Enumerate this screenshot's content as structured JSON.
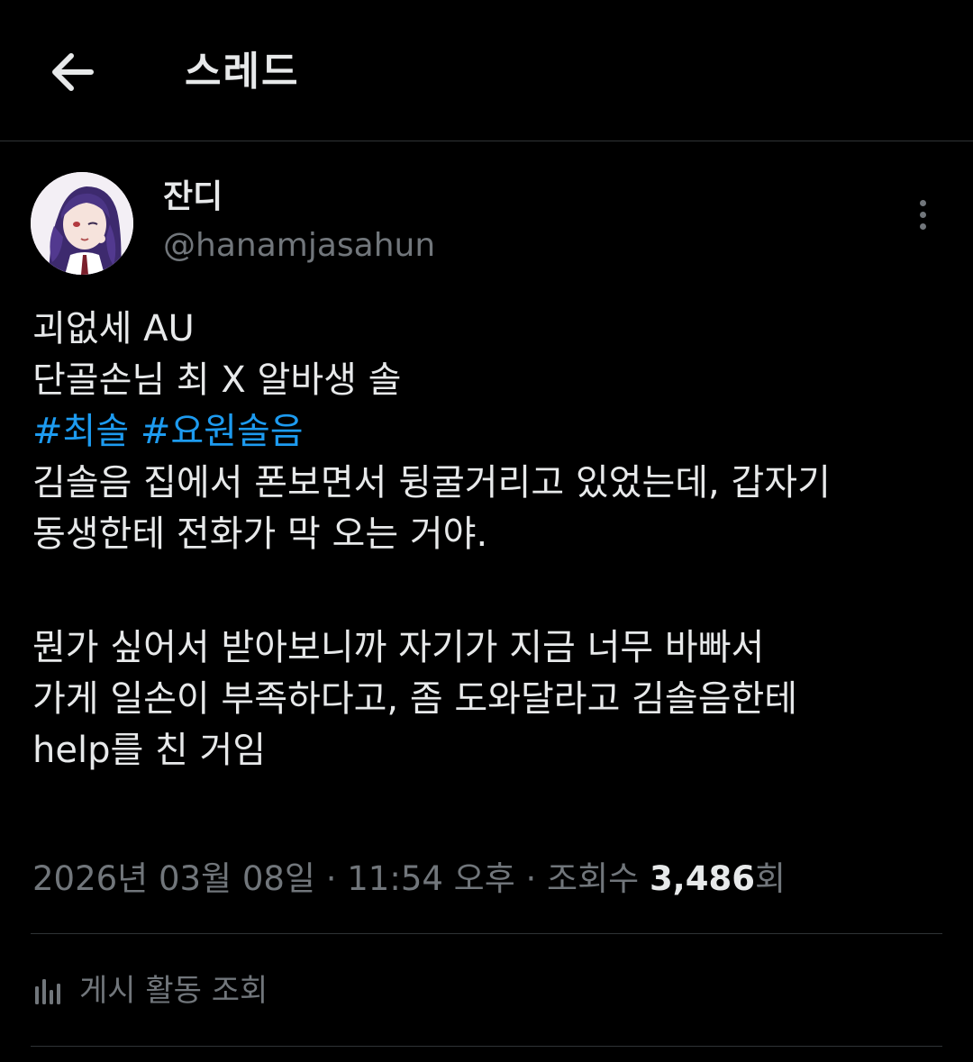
{
  "header": {
    "title": "스레드",
    "back_icon": "arrow-left-icon"
  },
  "post": {
    "author": {
      "display_name": "잔디",
      "handle": "@hanamjasahun",
      "avatar": "avatar-illustration"
    },
    "more_icon": "more-vertical-icon",
    "lines": {
      "l1": "괴없세 AU",
      "l2": "단골손님 최 X 알바생 솔",
      "hashtag1": "#최솔",
      "hashtag2": "#요원솔음",
      "l4": "김솔음 집에서 폰보면서 뒹굴거리고 있었는데, 갑자기",
      "l5": "동생한테 전화가 막 오는 거야.",
      "l6": "뭔가 싶어서 받아보니까 자기가 지금 너무 바빠서",
      "l7": "가게 일손이 부족하다고, 좀 도와달라고 김솔음한테",
      "l8": "help를 친 거임"
    },
    "meta": {
      "date": "2026년 03월 08일",
      "separator": "·",
      "time": "11:54 오후",
      "views_label": "조회수",
      "views_count": "3,486",
      "views_suffix": "회"
    }
  },
  "activity": {
    "label": "게시 활동 조회",
    "icon": "bar-chart-icon"
  },
  "colors": {
    "background": "#000000",
    "text": "#e7e9ea",
    "secondary": "#71767b",
    "hashtag": "#1d9bf0",
    "divider": "#2f3336"
  }
}
